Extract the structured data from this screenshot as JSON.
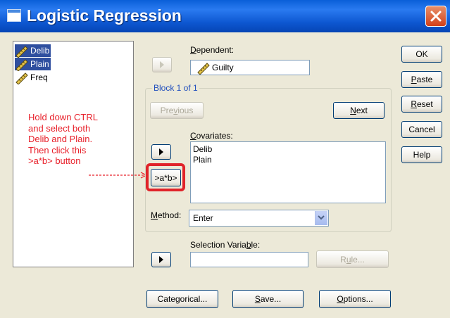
{
  "window": {
    "title": "Logistic Regression"
  },
  "variables": [
    {
      "name": "Delib",
      "selected": true
    },
    {
      "name": "Plain",
      "selected": true
    },
    {
      "name": "Freq",
      "selected": false
    }
  ],
  "annotation": {
    "lines": [
      "Hold down CTRL",
      "and select both",
      "Delib and Plain.",
      "Then click this",
      ">a*b> button"
    ],
    "color": "#e8202a"
  },
  "dependent": {
    "label": "Dependent:",
    "value": "Guilty"
  },
  "block": {
    "title": "Block 1 of 1",
    "previous": "Previous",
    "next": "Next"
  },
  "covariates": {
    "label": "Covariates:",
    "items": [
      "Delib",
      "Plain"
    ]
  },
  "interaction_button": ">a*b>",
  "method": {
    "label": "Method:",
    "value": "Enter"
  },
  "selection": {
    "label": "Selection Variable:",
    "value": "",
    "rule_button": "Rule..."
  },
  "side_buttons": {
    "ok": "OK",
    "paste": "Paste",
    "reset": "Reset",
    "cancel": "Cancel",
    "help": "Help"
  },
  "bottom_buttons": {
    "categorical": "Categorical...",
    "save": "Save...",
    "options": "Options..."
  },
  "colors": {
    "title_bar": "#0a5fd8",
    "highlight": "#e0232a",
    "selection": "#2f4f9f"
  }
}
